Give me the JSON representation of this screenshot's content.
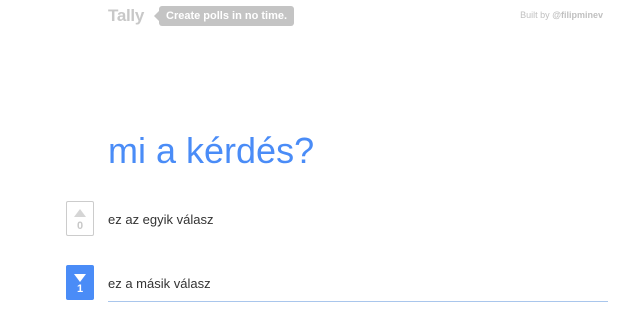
{
  "header": {
    "brand": "Tally",
    "tagline": "Create polls in no time.",
    "credit_prefix": "Built by",
    "credit_handle": "@filipminev"
  },
  "poll": {
    "question": "mi a kérdés?",
    "answers": [
      {
        "text": "ez az egyik válasz",
        "votes": "0",
        "voted": false
      },
      {
        "text": "ez a másik válasz",
        "votes": "1",
        "voted": true
      }
    ]
  },
  "colors": {
    "accent": "#4a8cf7",
    "muted": "#c4c4c4"
  },
  "icons": {
    "upvote": "triangle-up-icon",
    "downvote": "triangle-down-icon"
  }
}
